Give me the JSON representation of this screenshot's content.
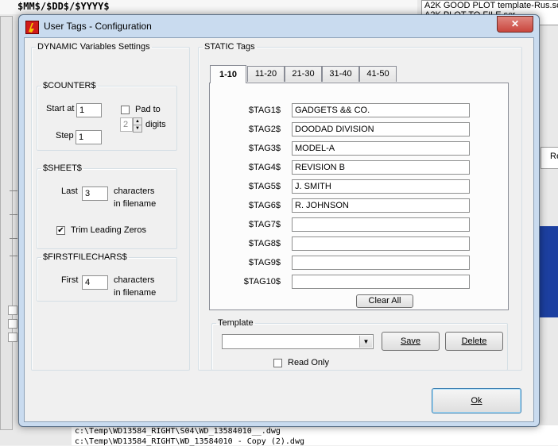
{
  "background": {
    "top_left_text": "$MM$/$DD$/$YYYY$",
    "top_right_lines": [
      "A2K GOOD PLOT template-Rus.scr",
      "A2K PLOT TO FILE.scr"
    ],
    "bottom_lines": [
      "c:\\Temp\\WD13584_RIGHT\\S04\\WD_13584010__.dwg",
      "c:\\Temp\\WD13584_RIGHT\\WD_13584010 - Copy (2).dwg"
    ],
    "right_label": "Re"
  },
  "window": {
    "title": "User Tags - Configuration",
    "close_label": "✕"
  },
  "dynamic": {
    "legend": "DYNAMIC Variables Settings",
    "counter": {
      "legend": "$COUNTER$",
      "start_label": "Start at",
      "start_value": "1",
      "pad_label": "Pad to",
      "pad_value": "2",
      "digits_label": "digits",
      "pad_checked": false,
      "step_label": "Step",
      "step_value": "1"
    },
    "sheet": {
      "legend": "$SHEET$",
      "last_label": "Last",
      "last_value": "3",
      "chars_label": "characters",
      "filename_label": "in filename",
      "trim_label": "Trim Leading Zeros",
      "trim_checked": true
    },
    "firstfile": {
      "legend": "$FIRSTFILECHARS$",
      "first_label": "First",
      "first_value": "4",
      "chars_label": "characters",
      "filename_label": "in filename"
    }
  },
  "static": {
    "legend": "STATIC Tags",
    "tabs": [
      "1-10",
      "11-20",
      "21-30",
      "31-40",
      "41-50"
    ],
    "active_tab": 0,
    "tags": [
      {
        "label": "$TAG1$",
        "value": "GADGETS && CO."
      },
      {
        "label": "$TAG2$",
        "value": "DOODAD DIVISION"
      },
      {
        "label": "$TAG3$",
        "value": "MODEL-A"
      },
      {
        "label": "$TAG4$",
        "value": "REVISION B"
      },
      {
        "label": "$TAG5$",
        "value": "J. SMITH"
      },
      {
        "label": "$TAG6$",
        "value": "R. JOHNSON"
      },
      {
        "label": "$TAG7$",
        "value": ""
      },
      {
        "label": "$TAG8$",
        "value": ""
      },
      {
        "label": "$TAG9$",
        "value": ""
      },
      {
        "label": "$TAG10$",
        "value": ""
      }
    ],
    "clear_all_label": "Clear All"
  },
  "template": {
    "legend": "Template",
    "selected": "",
    "save_label": "Save",
    "delete_label": "Delete",
    "readonly_label": "Read Only",
    "readonly_checked": false
  },
  "ok_label": "Ok",
  "colors": {
    "title_frame": "#c9dbef",
    "app_icon_red": "#d11a1a",
    "app_icon_yellow": "#f5c400",
    "close_red": "#c9463d",
    "bg_blue": "#1c3fa0"
  }
}
